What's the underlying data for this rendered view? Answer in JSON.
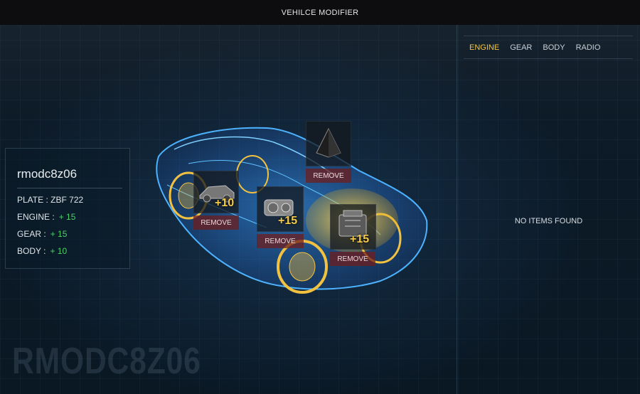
{
  "window": {
    "title": "VEHILCE MODIFIER"
  },
  "tabs": [
    {
      "label": "ENGINE",
      "active": true
    },
    {
      "label": "GEAR",
      "active": false
    },
    {
      "label": "BODY",
      "active": false
    },
    {
      "label": "RADIO",
      "active": false
    }
  ],
  "right_panel": {
    "empty_text": "NO ITEMS FOUND"
  },
  "vehicle": {
    "name": "rmodc8z06",
    "plate_label": "PLATE : ",
    "plate": "ZBF 722",
    "engine_label": "ENGINE :",
    "engine_value": "+ 15",
    "gear_label": "GEAR :",
    "gear_value": "+ 15",
    "body_label": "BODY :",
    "body_value": "+ 10",
    "watermark": "RMODC8Z06"
  },
  "installed_items": [
    {
      "slot": "radio",
      "bonus": "",
      "remove_label": "REMOVE"
    },
    {
      "slot": "body",
      "bonus": "+10",
      "remove_label": "REMOVE"
    },
    {
      "slot": "gear",
      "bonus": "+15",
      "remove_label": "REMOVE"
    },
    {
      "slot": "engine",
      "bonus": "+15",
      "remove_label": "REMOVE"
    }
  ],
  "colors": {
    "accent": "#f2c744",
    "positive": "#4bd06a",
    "remove_bg": "#6e1e1e"
  }
}
